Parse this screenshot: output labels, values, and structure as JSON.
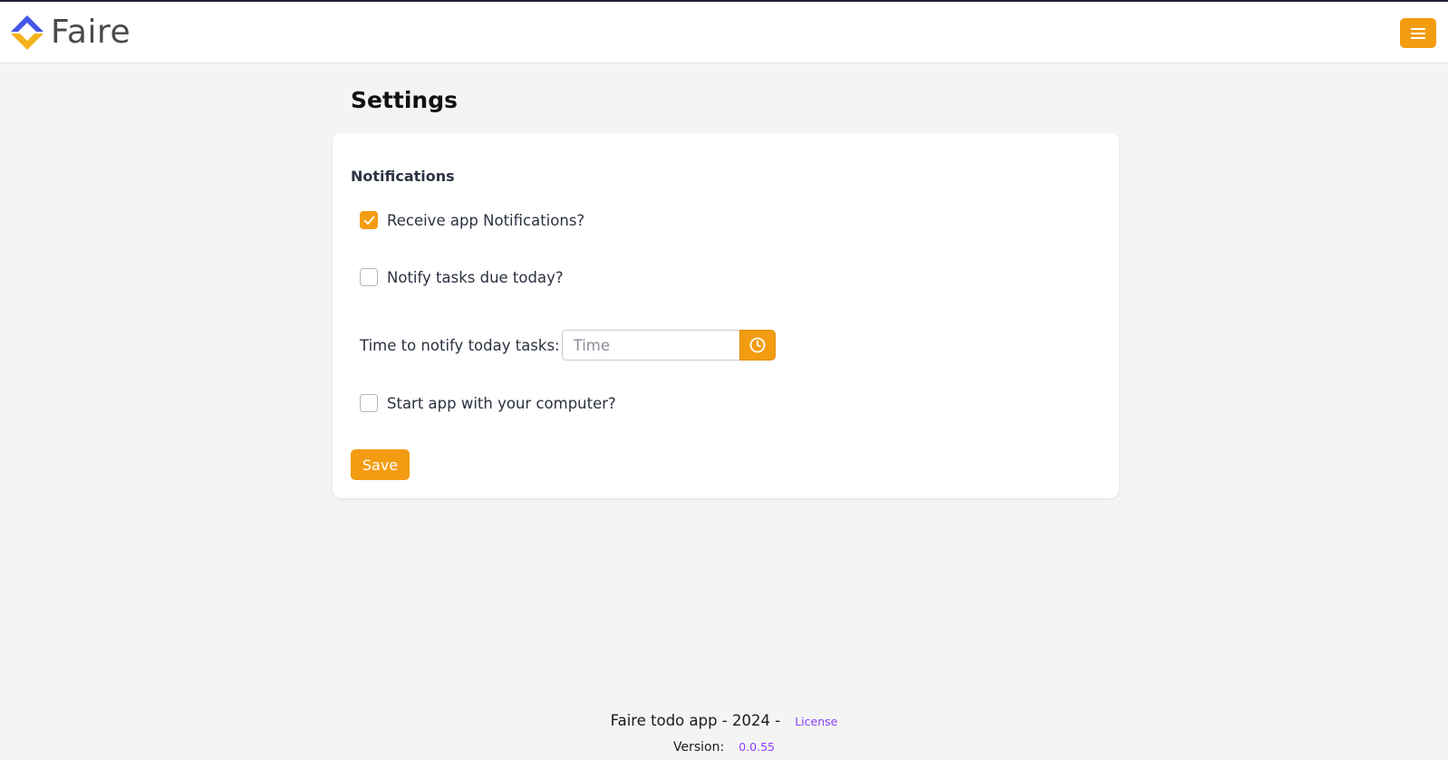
{
  "header": {
    "brand_name": "Faire",
    "logo_icon": "faire-logo-icon",
    "menu_icon": "hamburger-menu-icon",
    "accent_color": "#f39c12"
  },
  "page": {
    "title": "Settings"
  },
  "notifications": {
    "section_title": "Notifications",
    "receive_app_notifications": {
      "label": "Receive app Notifications?",
      "checked": true
    },
    "notify_tasks_due_today": {
      "label": "Notify tasks due today?",
      "checked": false
    },
    "time_to_notify": {
      "label": "Time to notify today tasks:",
      "placeholder": "Time",
      "value": "",
      "icon": "clock-icon"
    },
    "start_with_computer": {
      "label": "Start app with your computer?",
      "checked": false
    }
  },
  "actions": {
    "save_label": "Save"
  },
  "footer": {
    "app_text": "Faire todo app - 2024 -",
    "license_label": "License",
    "version_label": "Version:",
    "version_value": "0.0.55"
  }
}
